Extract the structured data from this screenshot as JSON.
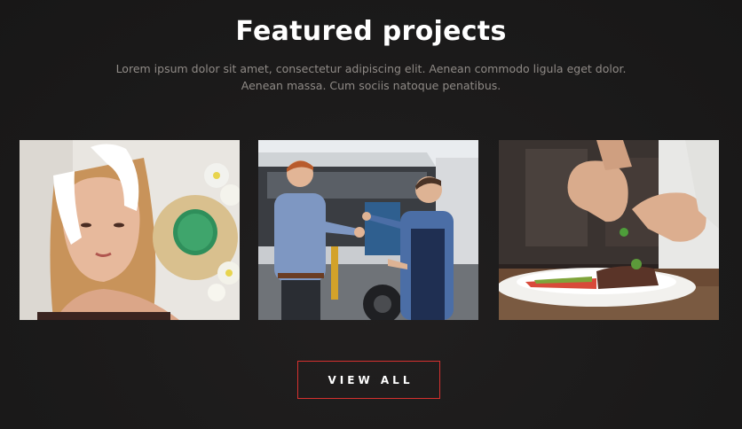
{
  "section": {
    "title": "Featured projects",
    "subtitle_line1": "Lorem ipsum dolor sit amet, consectetur adipiscing elit. Aenean commodo ligula eget dolor.",
    "subtitle_line2": "Aenean massa. Cum sociis natoque penatibus."
  },
  "projects": [
    {
      "image": "spa-facial-treatment-photo"
    },
    {
      "image": "car-service-key-handover-photo"
    },
    {
      "image": "chef-plating-steak-photo"
    }
  ],
  "cta": {
    "label": "VIEW ALL",
    "border_color": "#d6312f"
  }
}
